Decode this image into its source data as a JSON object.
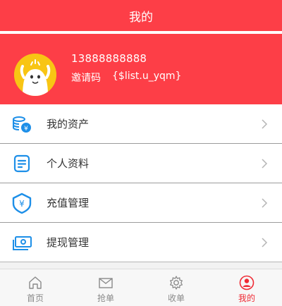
{
  "header": {
    "title": "我的"
  },
  "profile": {
    "phone": "13888888888",
    "invite_label": "邀请码",
    "invite_code": "{$list.u_yqm}"
  },
  "menu": [
    {
      "label": "我的资产",
      "icon": "coins-icon"
    },
    {
      "label": "个人资料",
      "icon": "document-icon"
    },
    {
      "label": "充值管理",
      "icon": "yuan-shield-icon"
    },
    {
      "label": "提现管理",
      "icon": "cash-icon"
    }
  ],
  "tabs": [
    {
      "label": "首页",
      "icon": "home-icon",
      "active": false
    },
    {
      "label": "抢单",
      "icon": "mail-icon",
      "active": false
    },
    {
      "label": "收单",
      "icon": "gear-icon",
      "active": false
    },
    {
      "label": "我的",
      "icon": "user-icon",
      "active": true
    }
  ],
  "colors": {
    "brand": "#fd3e47",
    "icon_blue": "#1d8fe8",
    "active_tab": "#ef2b35"
  }
}
